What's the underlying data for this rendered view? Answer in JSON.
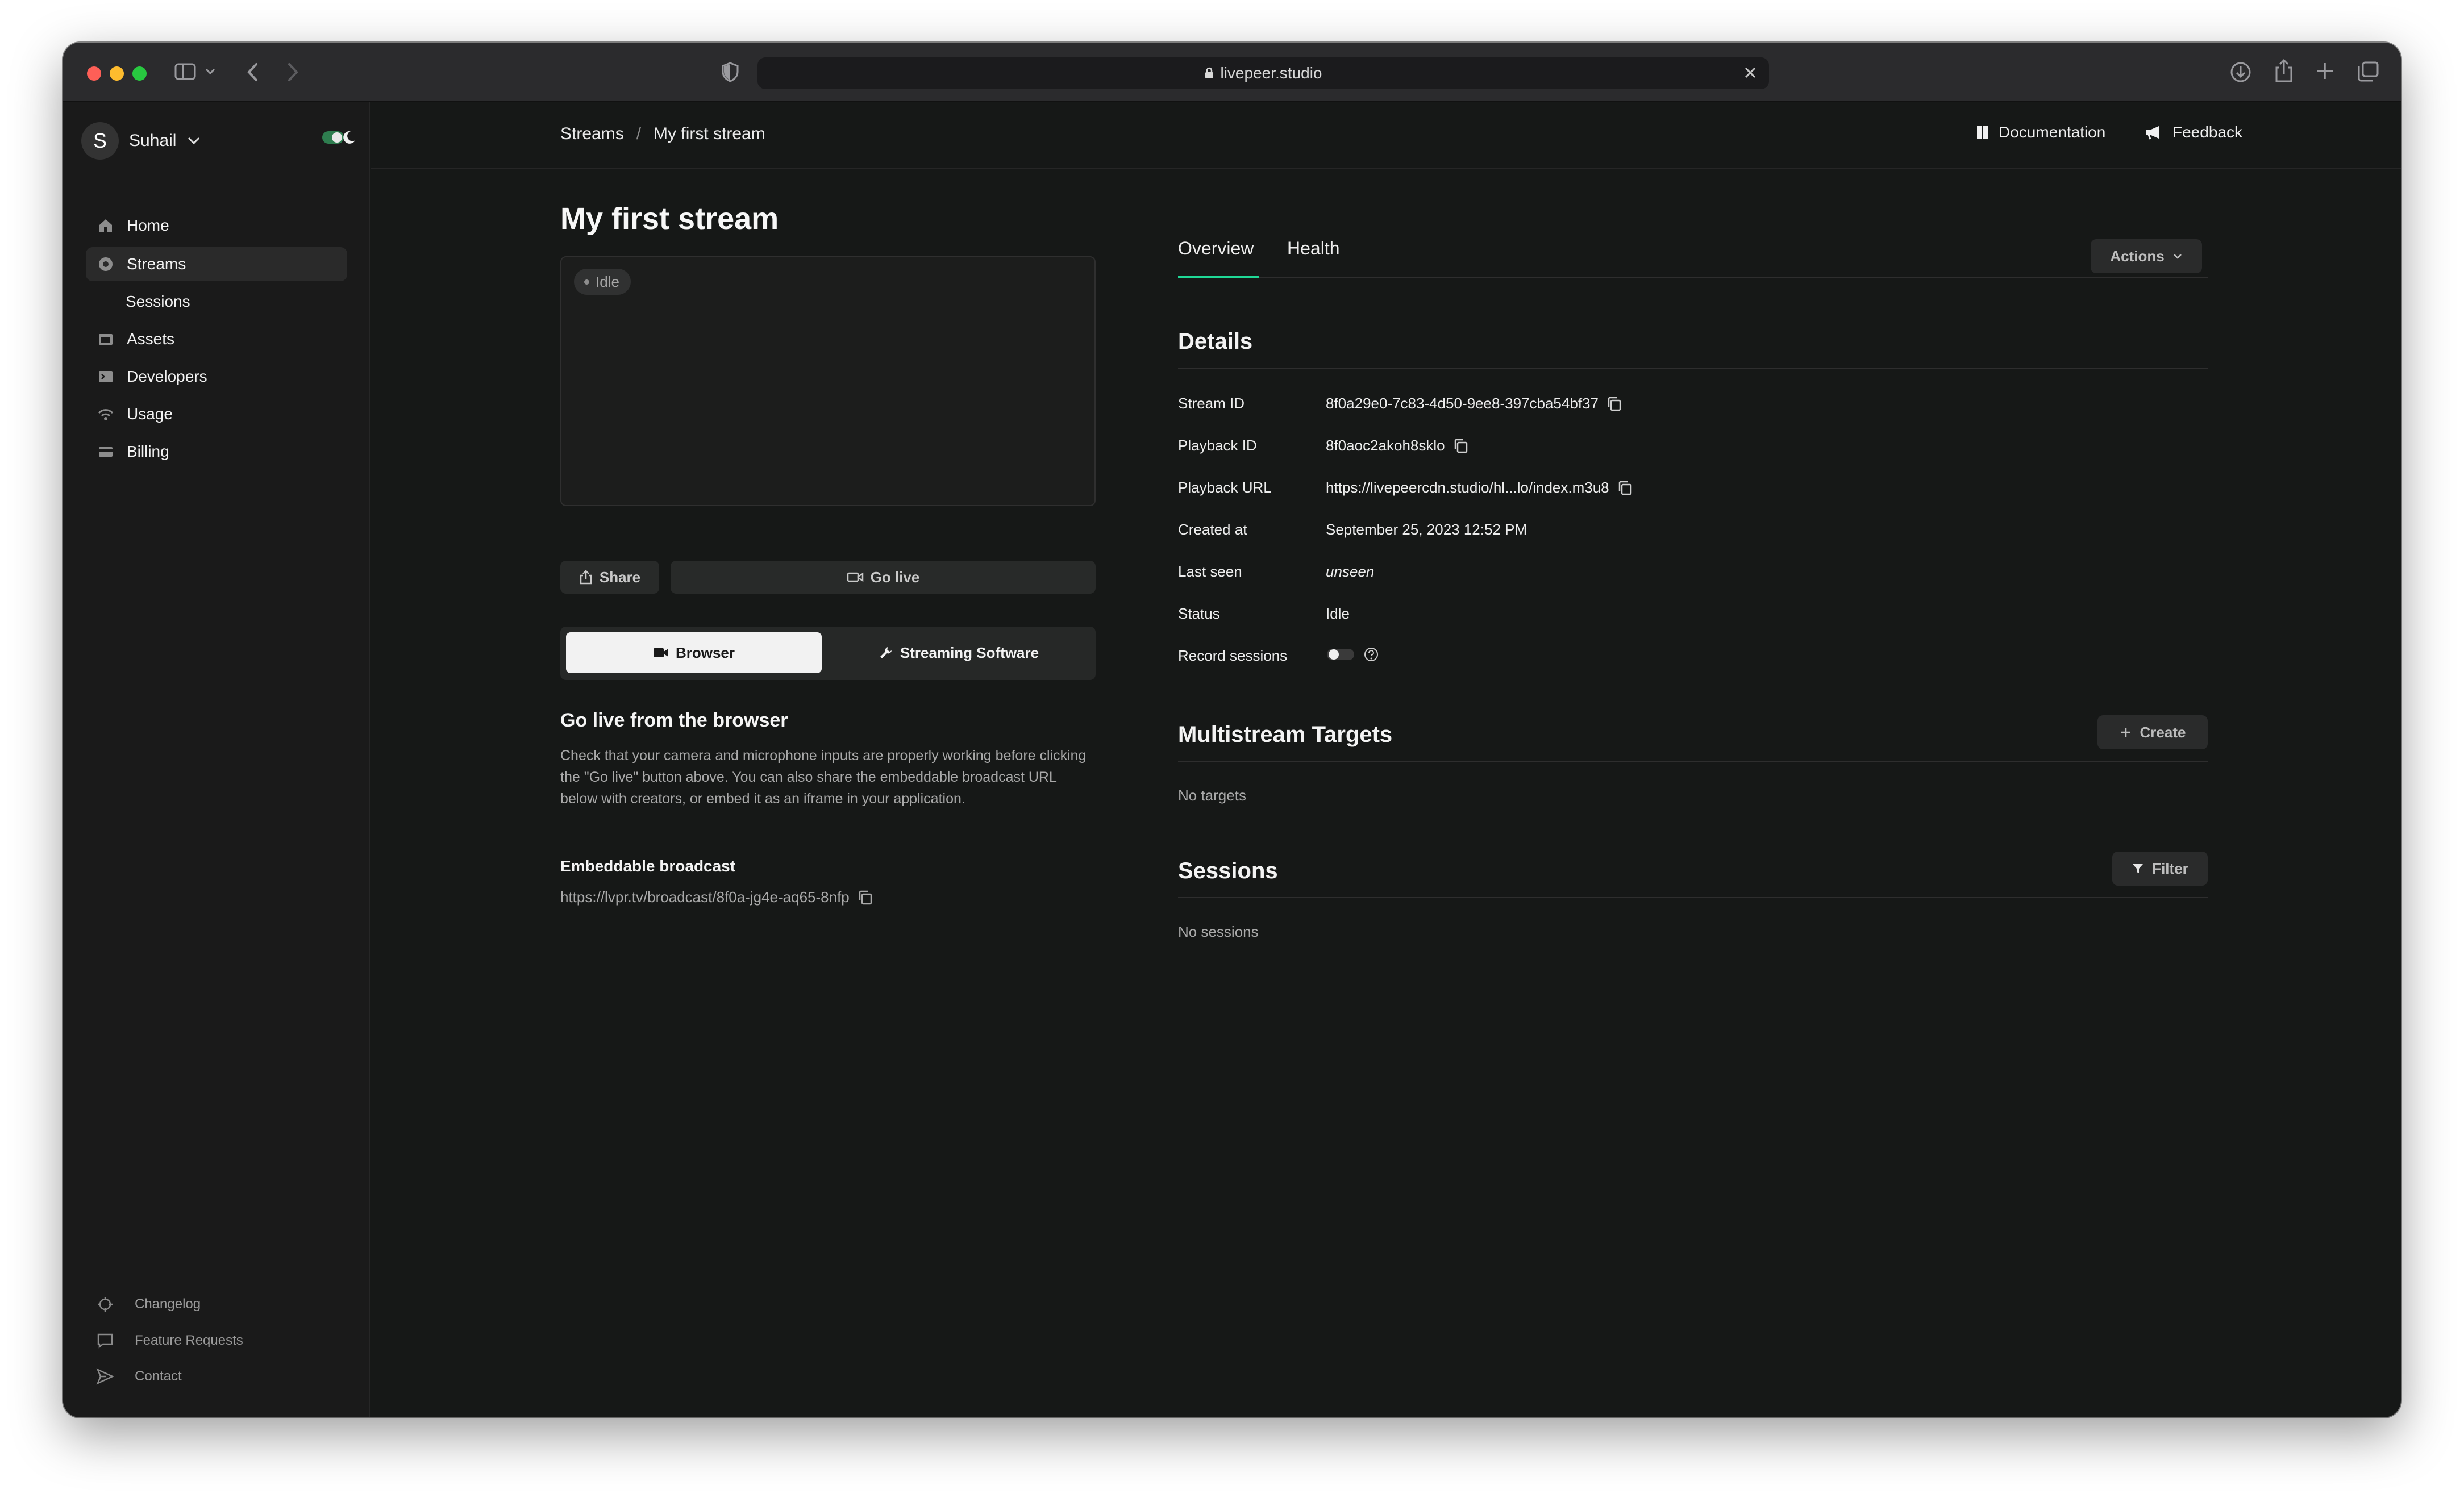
{
  "browser": {
    "url": "livepeer.studio"
  },
  "sidebar": {
    "user_initial": "S",
    "user_name": "Suhail",
    "nav": [
      {
        "label": "Home"
      },
      {
        "label": "Streams"
      },
      {
        "label": "Sessions"
      },
      {
        "label": "Assets"
      },
      {
        "label": "Developers"
      },
      {
        "label": "Usage"
      },
      {
        "label": "Billing"
      }
    ],
    "bottom_links": [
      {
        "label": "Changelog"
      },
      {
        "label": "Feature Requests"
      },
      {
        "label": "Contact"
      }
    ]
  },
  "header": {
    "breadcrumbs": [
      "Streams",
      "My first stream"
    ],
    "breadcrumb_separator": "/",
    "documentation": "Documentation",
    "feedback": "Feedback"
  },
  "stream": {
    "title": "My first stream",
    "status_badge": "Idle",
    "share_label": "Share",
    "go_live_label": "Go live",
    "source_tabs": [
      "Browser",
      "Streaming Software"
    ],
    "browser_heading": "Go live from the browser",
    "browser_text": "Check that your camera and microphone inputs are properly working before clicking the \"Go live\" button above. You can also share the embeddable broadcast URL below with creators, or embed it as an iframe in your application.",
    "embed_heading": "Embeddable broadcast",
    "embed_url": "https://lvpr.tv/broadcast/8f0a-jg4e-aq65-8nfp"
  },
  "tabs": [
    "Overview",
    "Health"
  ],
  "actions_label": "Actions",
  "details": {
    "title": "Details",
    "stream_id_label": "Stream ID",
    "stream_id": "8f0a29e0-7c83-4d50-9ee8-397cba54bf37",
    "playback_id_label": "Playback ID",
    "playback_id": "8f0aoc2akoh8sklo",
    "playback_url_label": "Playback URL",
    "playback_url": "https://livepeercdn.studio/hl...lo/index.m3u8",
    "created_at_label": "Created at",
    "created_at": "September 25, 2023 12:52 PM",
    "last_seen_label": "Last seen",
    "last_seen": "unseen",
    "status_label": "Status",
    "status": "Idle",
    "record_label": "Record sessions",
    "record_enabled": false
  },
  "multistream": {
    "title": "Multistream Targets",
    "create_label": "Create",
    "empty": "No targets"
  },
  "sessions": {
    "title": "Sessions",
    "filter_label": "Filter",
    "empty": "No sessions"
  },
  "colors": {
    "accent": "#1fd896",
    "background": "#161817",
    "sidebar": "#1a1a1a"
  }
}
